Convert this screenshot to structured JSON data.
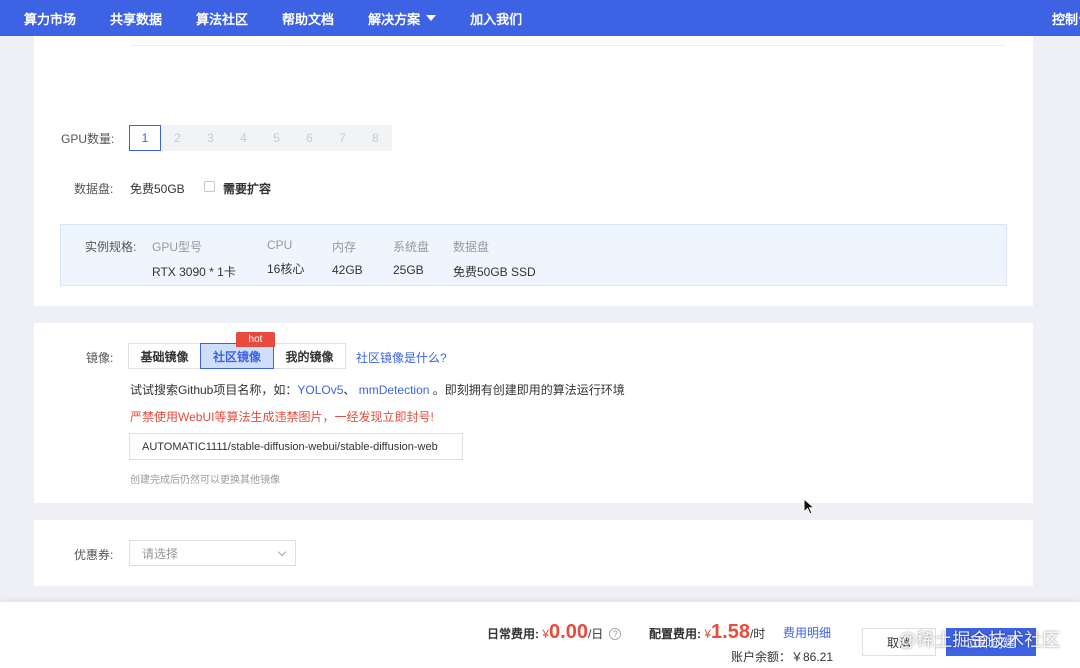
{
  "nav": {
    "items": [
      "算力市场",
      "共享数据",
      "算法社区",
      "帮助文档",
      "解决方案",
      "加入我们"
    ],
    "right": "控制台"
  },
  "gpu": {
    "label": "GPU数量:",
    "options": [
      "1",
      "2",
      "3",
      "4",
      "5",
      "6",
      "7",
      "8"
    ],
    "selected": "1"
  },
  "disk": {
    "label": "数据盘:",
    "free": "免费50GB",
    "expand_label": "需要扩容"
  },
  "spec": {
    "label": "实例规格:",
    "columns": [
      {
        "header": "GPU型号",
        "value": "RTX 3090 * 1卡"
      },
      {
        "header": "CPU",
        "value": "16核心"
      },
      {
        "header": "内存",
        "value": "42GB"
      },
      {
        "header": "系统盘",
        "value": "25GB"
      },
      {
        "header": "数据盘",
        "value": "免费50GB SSD"
      }
    ]
  },
  "mirror": {
    "label": "镜像:",
    "tabs": [
      "基础镜像",
      "社区镜像",
      "我的镜像"
    ],
    "active_tab": "社区镜像",
    "hot_badge": "hot",
    "help_link": "社区镜像是什么?",
    "hint_prefix": "试试搜索Github项目名称，如：",
    "hint_link1": "YOLOv5",
    "hint_sep": "、",
    "hint_link2": "mmDetection",
    "hint_suffix": "。即刻拥有创建即用的算法运行环境",
    "warning": "严禁使用WebUI等算法生成违禁图片，一经发现立即封号!",
    "input_value": "AUTOMATIC1111/stable-diffusion-webui/stable-diffusion-web",
    "note": "创建完成后仍然可以更换其他镜像"
  },
  "coupon": {
    "label": "优惠券:",
    "placeholder": "请选择"
  },
  "footer": {
    "daily_label": "日常费用:",
    "daily_yen": "¥",
    "daily_amount": "0.00",
    "daily_unit": "/日",
    "daily_help": "?",
    "config_label": "配置费用:",
    "config_yen": "¥",
    "config_amount": "1.58",
    "config_unit": "/时",
    "fee_detail": "费用明细",
    "balance": "账户余额：￥86.21",
    "cancel": "取消",
    "confirm": "立即创建",
    "watermark": "@稀土掘金技术社区"
  },
  "colors": {
    "primary": "#3d63e4",
    "danger": "#e84b3c",
    "spec_bg": "#eef5fe"
  }
}
